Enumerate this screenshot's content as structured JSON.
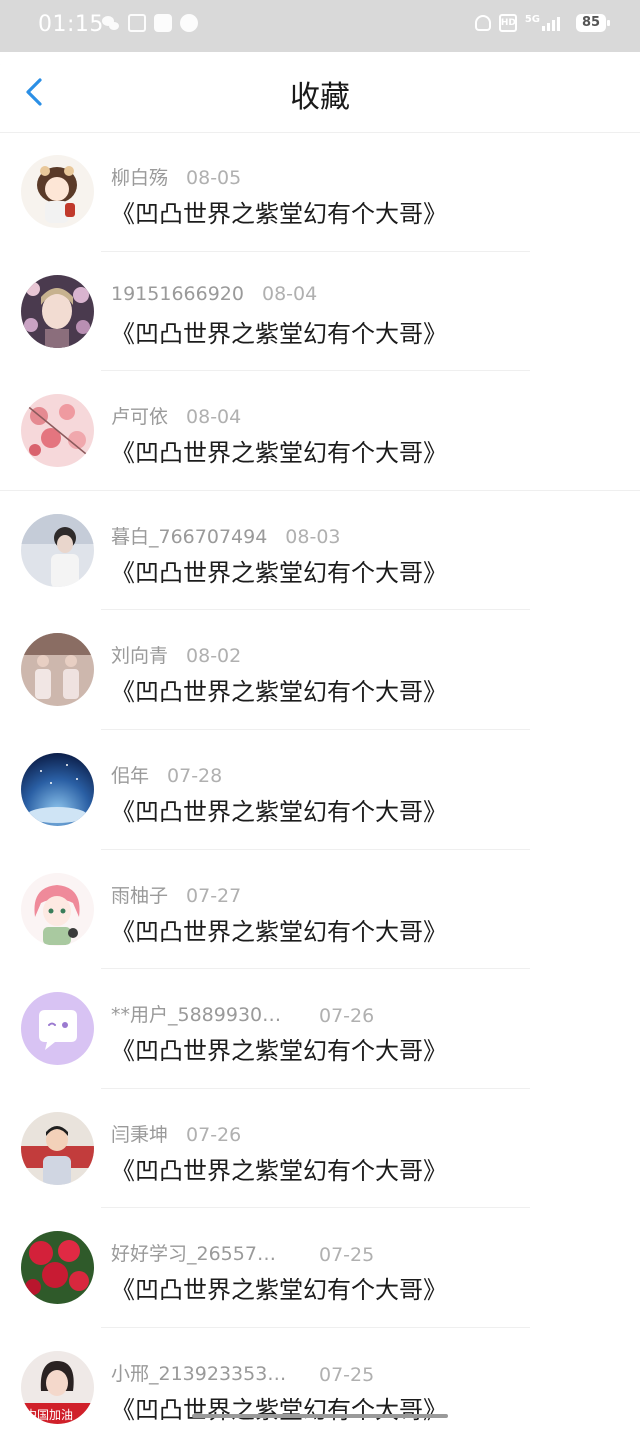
{
  "status": {
    "time": "01:15",
    "hd": "HD",
    "network": "5G",
    "battery": "85"
  },
  "header": {
    "title": "收藏"
  },
  "favorites": [
    {
      "user": "柳白殇",
      "date": "08-05",
      "title": "《凹凸世界之紫堂幻有个大哥》",
      "avatar": "anime-girl-avatar"
    },
    {
      "user": "19151666920",
      "date": "08-04",
      "title": "《凹凸世界之紫堂幻有个大哥》",
      "avatar": "woman-flowers-avatar"
    },
    {
      "user": "卢可依",
      "date": "08-04",
      "title": "《凹凸世界之紫堂幻有个大哥》",
      "avatar": "pink-blossom-avatar"
    },
    {
      "user": "暮白_766707494",
      "date": "08-03",
      "title": "《凹凸世界之紫堂幻有个大哥》",
      "avatar": "boy-photo-avatar"
    },
    {
      "user": "刘向青",
      "date": "08-02",
      "title": "《凹凸世界之紫堂幻有个大哥》",
      "avatar": "group-photo-avatar"
    },
    {
      "user": "佀年",
      "date": "07-28",
      "title": "《凹凸世界之紫堂幻有个大哥》",
      "avatar": "starry-sky-avatar"
    },
    {
      "user": "雨柚子",
      "date": "07-27",
      "title": "《凹凸世界之紫堂幻有个大哥》",
      "avatar": "anime-pink-hair-avatar"
    },
    {
      "user": "**用户_5889930…",
      "date": "07-26",
      "title": "《凹凸世界之紫堂幻有个大哥》",
      "avatar": "default-chat-avatar"
    },
    {
      "user": "闫秉坤",
      "date": "07-26",
      "title": "《凹凸世界之紫堂幻有个大哥》",
      "avatar": "child-photo-avatar"
    },
    {
      "user": "好好学习_26557…",
      "date": "07-25",
      "title": "《凹凸世界之紫堂幻有个大哥》",
      "avatar": "red-roses-avatar"
    },
    {
      "user": "小邢_213923353…",
      "date": "07-25",
      "title": "《凹凸世界之紫堂幻有个大哥》",
      "avatar": "girl-photo-avatar",
      "avatar_text": "中国加油"
    }
  ],
  "colors": {
    "accent": "#2b8fe6",
    "status_bar": "#d9d9d9",
    "meta_text": "#9a9a9a",
    "title_text": "#1c1c1c"
  }
}
